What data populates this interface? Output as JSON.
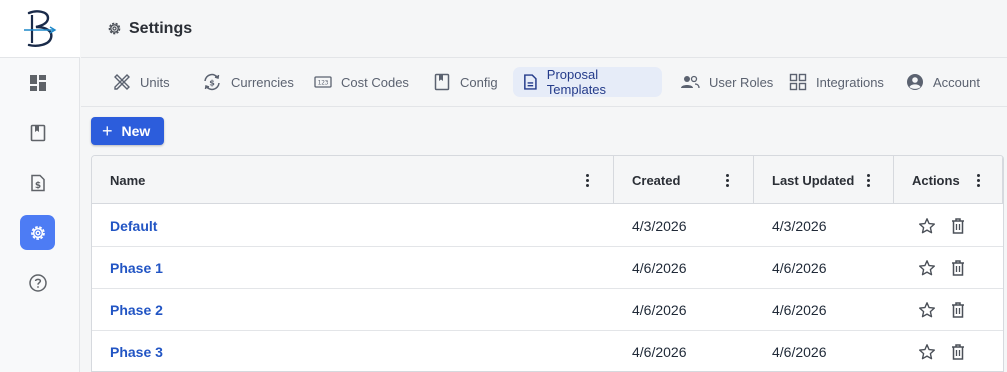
{
  "app": {
    "logo_letter": "B"
  },
  "header": {
    "title": "Settings"
  },
  "rail": {
    "items": [
      {
        "name": "dashboard",
        "icon": "dashboard-icon"
      },
      {
        "name": "book",
        "icon": "book-icon"
      },
      {
        "name": "billing",
        "icon": "dollar-document-icon"
      },
      {
        "name": "settings",
        "icon": "gear-icon",
        "active": true
      },
      {
        "name": "help",
        "icon": "help-circle-icon"
      }
    ]
  },
  "tabs": [
    {
      "label": "Units",
      "icon": "ruler-pencil-icon"
    },
    {
      "label": "Currencies",
      "icon": "currency-exchange-icon"
    },
    {
      "label": "Cost Codes",
      "icon": "cost-code-icon"
    },
    {
      "label": "Config",
      "icon": "bookmark-icon"
    },
    {
      "label": "Proposal Templates",
      "icon": "document-icon",
      "active": true
    },
    {
      "label": "User Roles",
      "icon": "users-icon"
    },
    {
      "label": "Integrations",
      "icon": "grid-icon"
    },
    {
      "label": "Account",
      "icon": "account-circle-icon"
    }
  ],
  "toolbar": {
    "new_label": "New",
    "new_symbol": "+"
  },
  "table": {
    "columns": [
      "Name",
      "Created",
      "Last Updated",
      "Actions"
    ],
    "rows": [
      {
        "name": "Default",
        "created": "4/3/2026",
        "updated": "4/3/2026"
      },
      {
        "name": "Phase 1",
        "created": "4/6/2026",
        "updated": "4/6/2026"
      },
      {
        "name": "Phase 2",
        "created": "4/6/2026",
        "updated": "4/6/2026"
      },
      {
        "name": "Phase 3",
        "created": "4/6/2026",
        "updated": "4/6/2026"
      }
    ]
  },
  "colors": {
    "accent": "#2c5ddc",
    "active_tab_bg": "#e6ecf8",
    "link": "#2255c4",
    "rail_active": "#4d7cf4"
  }
}
